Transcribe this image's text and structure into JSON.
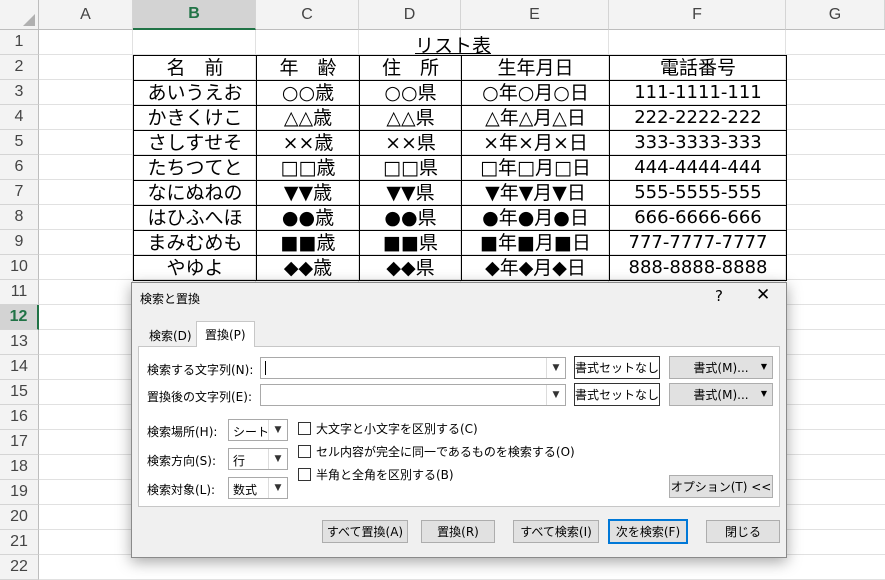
{
  "columns": [
    "A",
    "B",
    "C",
    "D",
    "E",
    "F",
    "G"
  ],
  "selected_column": "B",
  "rows": [
    "1",
    "2",
    "3",
    "4",
    "5",
    "6",
    "7",
    "8",
    "9",
    "10",
    "11",
    "12",
    "13",
    "14",
    "15",
    "16",
    "17",
    "18",
    "19",
    "20",
    "21",
    "22"
  ],
  "selected_row": "12",
  "sheet": {
    "title": "リスト表",
    "headers": [
      "名　前",
      "年　齢",
      "住　所",
      "生年月日",
      "電話番号"
    ],
    "records": [
      [
        "あいうえお",
        "○○歳",
        "○○県",
        "○年○月○日",
        "111-1111-111"
      ],
      [
        "かきくけこ",
        "△△歳",
        "△△県",
        "△年△月△日",
        "222-2222-222"
      ],
      [
        "さしすせそ",
        "××歳",
        "××県",
        "×年×月×日",
        "333-3333-333"
      ],
      [
        "たちつてと",
        "□□歳",
        "□□県",
        "□年□月□日",
        "444-4444-444"
      ],
      [
        "なにぬねの",
        "▼▼歳",
        "▼▼県",
        "▼年▼月▼日",
        "555-5555-555"
      ],
      [
        "はひふへほ",
        "●●歳",
        "●●県",
        "●年●月●日",
        "666-6666-666"
      ],
      [
        "まみむめも",
        "■■歳",
        "■■県",
        "■年■月■日",
        "777-7777-7777"
      ],
      [
        "やゆよ",
        "◆◆歳",
        "◆◆県",
        "◆年◆月◆日",
        "888-8888-8888"
      ]
    ]
  },
  "dialog": {
    "title": "検索と置換",
    "help": "?",
    "close": "✕",
    "tabs": [
      "検索(D)",
      "置換(P)"
    ],
    "active_tab": "置換(P)",
    "find_label": "検索する文字列(N):",
    "find_value": "",
    "replace_label": "置換後の文字列(E):",
    "replace_value": "",
    "no_format_label": "書式セットなし",
    "format_label": "書式(M)...",
    "within_label": "検索場所(H):",
    "within_value": "シート",
    "search_label": "検索方向(S):",
    "search_value": "行",
    "lookin_label": "検索対象(L):",
    "lookin_value": "数式",
    "options": [
      {
        "label": "大文字と小文字を区別する(C)",
        "checked": false
      },
      {
        "label": "セル内容が完全に同一であるものを検索する(O)",
        "checked": false
      },
      {
        "label": "半角と全角を区別する(B)",
        "checked": false
      }
    ],
    "options_button": "オプション(T) <<",
    "buttons": {
      "replace_all": "すべて置換(A)",
      "replace": "置換(R)",
      "find_all": "すべて検索(I)",
      "find_next": "次を検索(F)",
      "close": "閉じる"
    }
  }
}
